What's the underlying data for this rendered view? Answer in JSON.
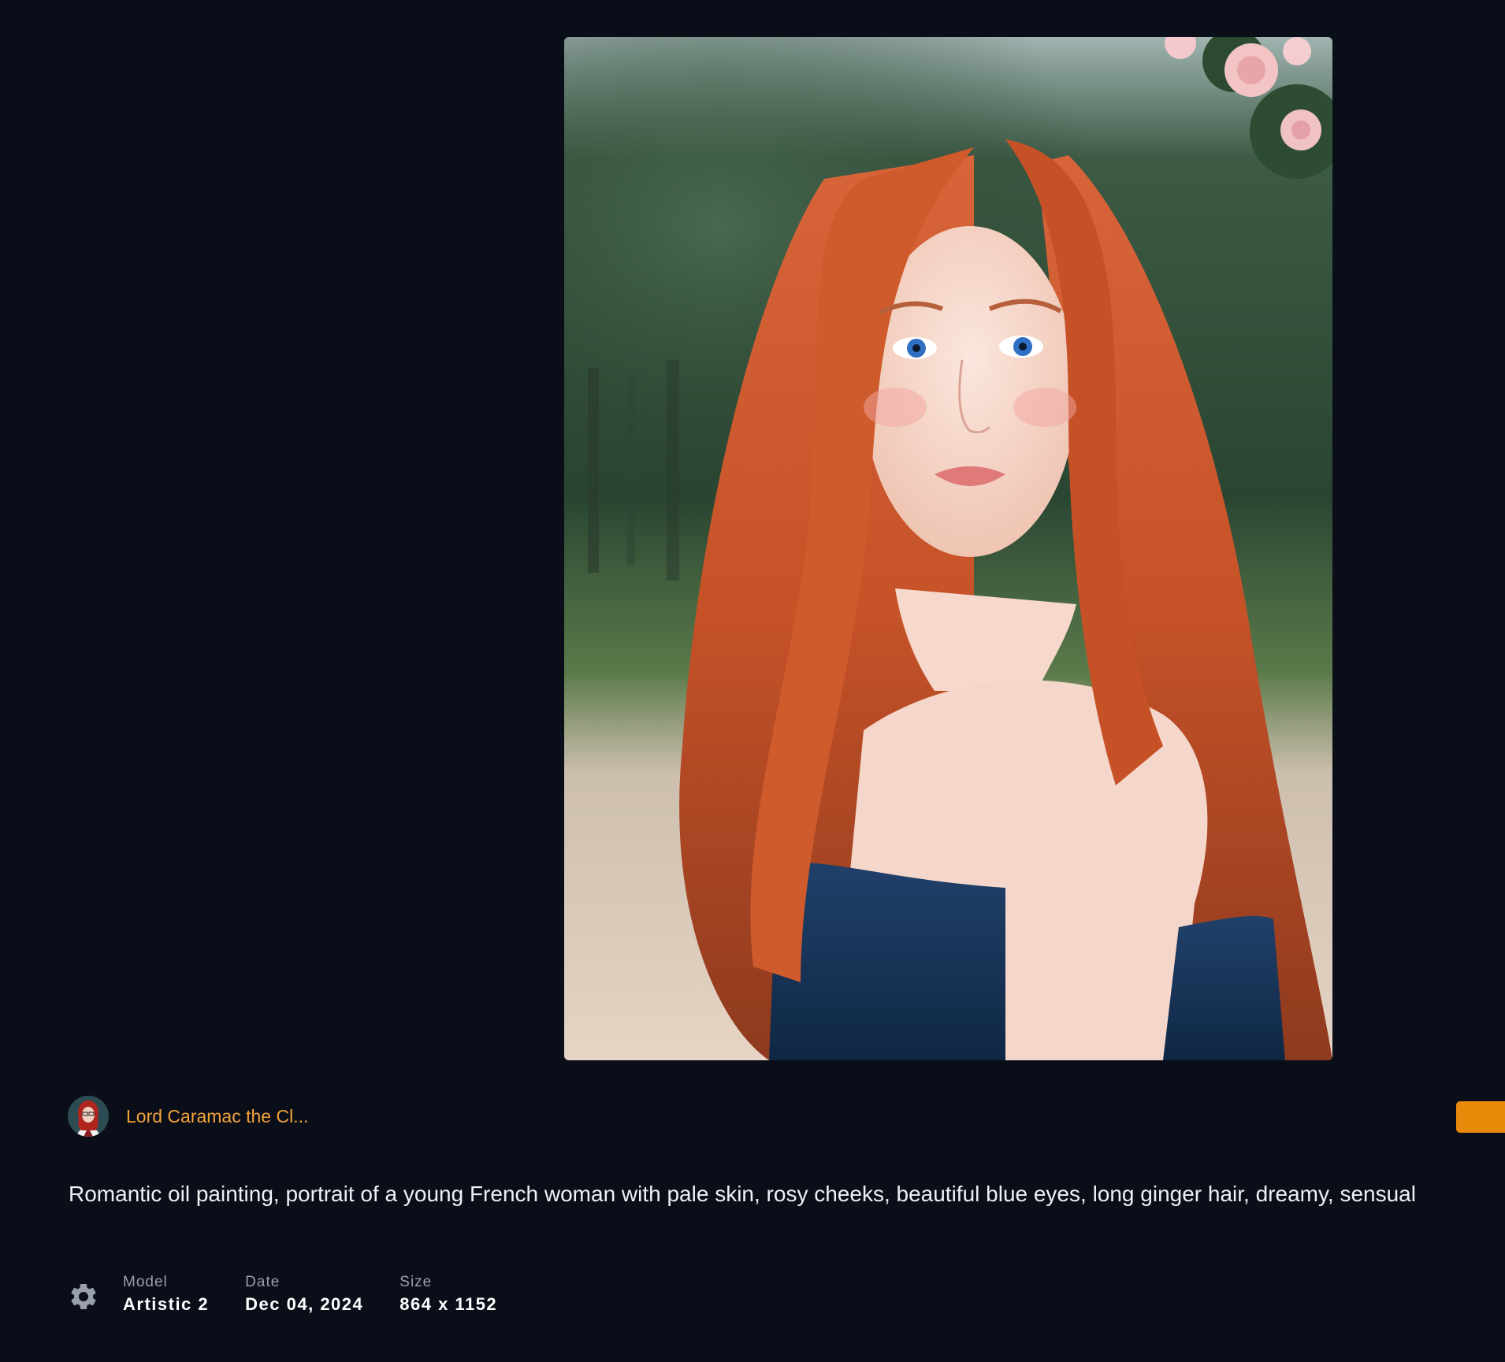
{
  "author": {
    "name": "Lord Caramac the Cl..."
  },
  "prompt": "Romantic oil painting, portrait of a young French woman with pale skin, rosy cheeks, beautiful blue eyes, long ginger hair, dreamy, sensual",
  "meta": {
    "model": {
      "label": "Model",
      "value": "Artistic 2"
    },
    "date": {
      "label": "Date",
      "value": "Dec 04, 2024"
    },
    "size": {
      "label": "Size",
      "value": "864 x 1152"
    }
  },
  "colors": {
    "background": "#0a0e18",
    "accent": "#e8890a",
    "author_link": "#f3a23a",
    "muted_label": "#9aa0ab"
  },
  "icons": {
    "settings": "gear-icon"
  }
}
